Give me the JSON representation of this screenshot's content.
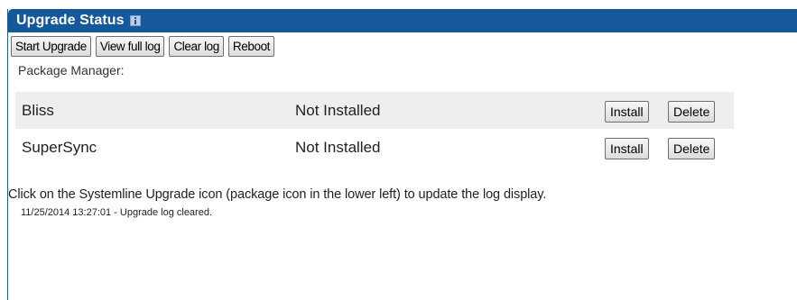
{
  "header": {
    "title": "Upgrade Status",
    "info_icon": "info-icon"
  },
  "toolbar": {
    "start_upgrade": "Start Upgrade",
    "view_full_log": "View full log",
    "clear_log": "Clear log",
    "reboot": "Reboot"
  },
  "package_manager": {
    "label": "Package Manager:",
    "packages": [
      {
        "name": "Bliss",
        "status": "Not Installed",
        "install_label": "Install",
        "delete_label": "Delete"
      },
      {
        "name": "SuperSync",
        "status": "Not Installed",
        "install_label": "Install",
        "delete_label": "Delete"
      }
    ]
  },
  "hint_text": "Click on the Systemline Upgrade icon (package icon in the lower left) to update the log display.",
  "log": {
    "entries": [
      "11/25/2014 13:27:01 - Upgrade log cleared."
    ]
  },
  "colors": {
    "header_bg": "#16589c",
    "row_shade": "#eeeeee"
  }
}
